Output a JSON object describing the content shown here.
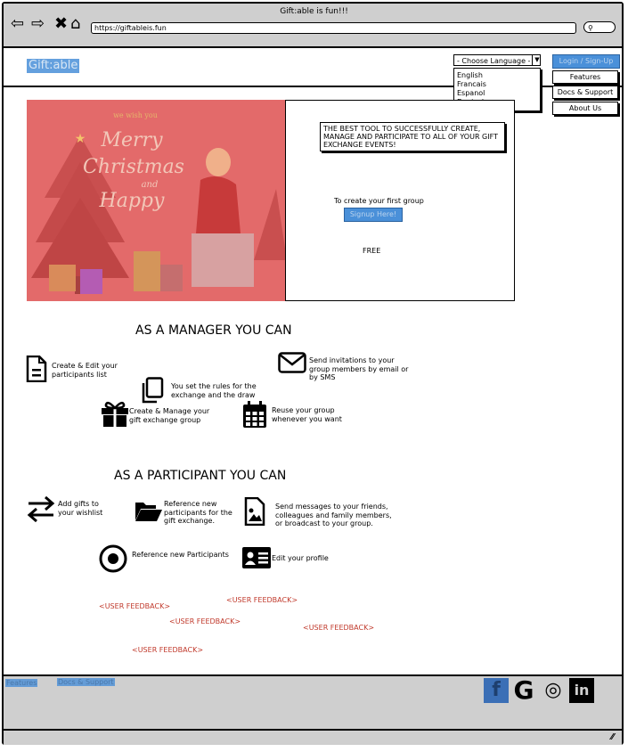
{
  "browser": {
    "window_title": "Gift:able is fun!!!",
    "url": "https://giftableis.fun",
    "search_icon": "search-icon"
  },
  "header": {
    "logo": "Gift:able",
    "language_select": "- Choose Language -",
    "languages": [
      "English",
      "Francais",
      "Espanol",
      "Deutsch"
    ],
    "login_label": "Login / Sign-Up",
    "nav": [
      "Features",
      "Docs & Support",
      "About Us"
    ]
  },
  "hero": {
    "image_title": "we wish you Merry Christmas and Happy",
    "tagline": "THE BEST TOOL TO SUCCESSFULLY CREATE, MANAGE AND PARTICIPATE TO ALL OF YOUR GIFT EXCHANGE EVENTS!",
    "cta_text": "To create your first group",
    "signup_label": "Signup Here!",
    "price": "FREE"
  },
  "manager": {
    "heading": "AS A MANAGER YOU CAN",
    "features": [
      {
        "icon": "document-icon",
        "text": "Create & Edit your participants list"
      },
      {
        "icon": "envelope-icon",
        "text": "Send invitations to your group members by email or by SMS"
      },
      {
        "icon": "copy-icon",
        "text": "You set the rules for the exchange and the draw"
      },
      {
        "icon": "gift-icon",
        "text": "Create & Manage your gift exchange group"
      },
      {
        "icon": "calendar-icon",
        "text": "Reuse your group whenever you want"
      }
    ]
  },
  "participant": {
    "heading": "AS A PARTICIPANT YOU CAN",
    "features": [
      {
        "icon": "exchange-icon",
        "text": "Add gifts to your wishlist"
      },
      {
        "icon": "folder-open-icon",
        "text": "Reference new participants for the gift exchange."
      },
      {
        "icon": "image-file-icon",
        "text": "Send messages to your friends, colleagues and family members, or broadcast to your group."
      },
      {
        "icon": "dot-circle-icon",
        "text": "Reference new Participants"
      },
      {
        "icon": "id-card-icon",
        "text": "Edit your profile"
      }
    ]
  },
  "feedback": [
    "<USER FEEDBACK>",
    "<USER FEEDBACK>",
    "<USER FEEDBACK>",
    "<USER FEEDBACK>",
    "<USER FEEDBACK>"
  ],
  "footer": {
    "links": [
      "Features",
      "Docs & Support"
    ],
    "social": [
      {
        "icon": "facebook-icon",
        "glyph": "f",
        "color": "#3b6fb6"
      },
      {
        "icon": "google-icon",
        "glyph": "G",
        "color": "#000000"
      },
      {
        "icon": "instagram-icon",
        "glyph": "◎",
        "color": "#000000"
      },
      {
        "icon": "linkedin-icon",
        "glyph": "in",
        "color": "#000000"
      }
    ]
  },
  "colors": {
    "accent": "#4a90d9",
    "hero": "#e36a6a",
    "feedback": "#c0392b",
    "chrome": "#cfcfcf"
  }
}
